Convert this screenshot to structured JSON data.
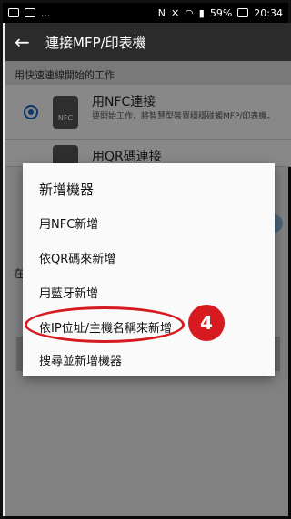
{
  "status_bar": {
    "left_icons": [
      "image-icon",
      "ellipsis"
    ],
    "ellipsis": "...",
    "nfc": "N",
    "battery": "59%",
    "time": "20:34"
  },
  "app_bar": {
    "title": "連接MFP/印表機"
  },
  "background": {
    "section_header": "用快速連線開始的工作",
    "options": [
      {
        "title": "用NFC連接",
        "description": "要開始工作，將智慧型裝置穩穩碰觸MFP/印表機。",
        "icon_text": "NFC",
        "selected": true
      },
      {
        "title": "用QR碼連接",
        "selected": false
      }
    ],
    "peek_letter": "在"
  },
  "dialog": {
    "title": "新增機器",
    "items": [
      "用NFC新增",
      "依QR碼來新增",
      "用藍牙新增",
      "依IP位址/主機名稱來新增",
      "搜尋並新增機器"
    ]
  },
  "annotation": {
    "step_number": "4",
    "color": "#d71920"
  }
}
